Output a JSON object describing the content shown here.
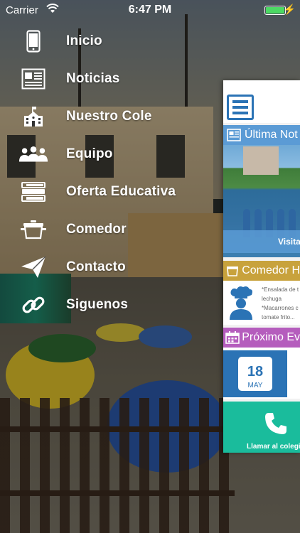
{
  "status_bar": {
    "carrier": "Carrier",
    "time": "6:47 PM",
    "battery_color": "#4cd964"
  },
  "menu": {
    "items": [
      {
        "label": "Inicio",
        "icon": "smartphone-icon"
      },
      {
        "label": "Noticias",
        "icon": "newspaper-icon"
      },
      {
        "label": "Nuestro Cole",
        "icon": "school-building-icon"
      },
      {
        "label": "Equipo",
        "icon": "team-icon"
      },
      {
        "label": "Oferta Educativa",
        "icon": "books-icon"
      },
      {
        "label": "Comedor",
        "icon": "cooking-pot-icon"
      },
      {
        "label": "Contacto",
        "icon": "paper-plane-icon"
      },
      {
        "label": "Siguenos",
        "icon": "link-icon"
      }
    ]
  },
  "app_panel": {
    "latest_news": {
      "title": "Última Not",
      "caption": "Visita"
    },
    "canteen": {
      "title": "Comedor H",
      "lines": [
        "*Ensalada de t",
        "lechuga",
        "*Macarrones c",
        "tomate frito..."
      ]
    },
    "next_event": {
      "title": "Próximo Ev",
      "day": "18",
      "month": "MAY"
    },
    "call_button": {
      "label": "Llamar al colegio"
    },
    "colors": {
      "blue": "#5b9bd5",
      "gold": "#c8a23c",
      "purple": "#b55dbd",
      "teal": "#1abc9c",
      "icon_blue": "#2b73b5"
    }
  }
}
